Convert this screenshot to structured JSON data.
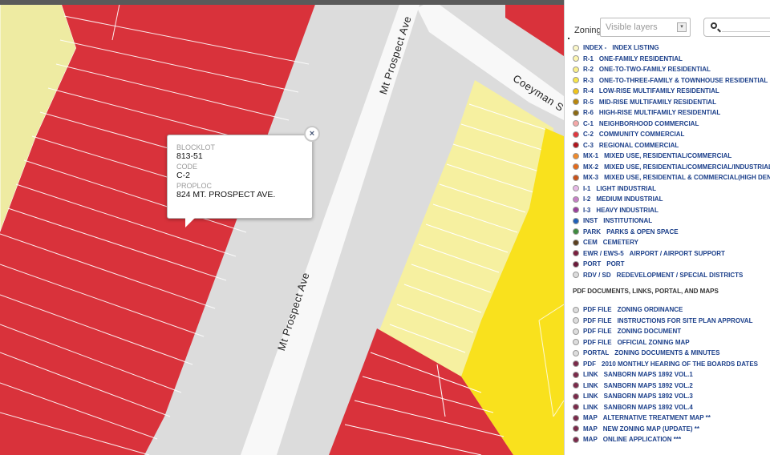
{
  "colors": {
    "commercial": "#d9323b",
    "light_residential": "#f6f0a0",
    "multi_residential": "#f9e11d",
    "pale_residential": "#eeeba2",
    "street": "#f8f8f8",
    "sidewalk": "#dcdcdc",
    "parcel_line": "#ffffff",
    "link_text": "#1b3f8a"
  },
  "map": {
    "streets": [
      {
        "name": "Mt Prospect Ave",
        "label": "Mt Prospect Ave"
      },
      {
        "name": "Mt Prospect Ave",
        "label": "Mt Prospect Ave"
      },
      {
        "name": "Coeyman St",
        "label": "Coeyman S"
      }
    ]
  },
  "popup": {
    "fields": [
      {
        "label": "BLOCKLOT",
        "value": "813-51"
      },
      {
        "label": "CODE",
        "value": "C-2"
      },
      {
        "label": "PROPLOC",
        "value": "824 MT. PROSPECT AVE."
      }
    ],
    "close_glyph": "×",
    "close_icon": "close-icon"
  },
  "panel": {
    "title": "Zoning",
    "layers_placeholder": "Visible layers",
    "search_icon": "search-icon",
    "legend": [
      {
        "code": "INDEX -",
        "desc": "INDEX LISTING",
        "color": "#fbf7c8"
      },
      {
        "code": "R-1",
        "desc": "ONE-FAMILY RESIDENTIAL",
        "color": "#fdf6b0"
      },
      {
        "code": "R-2",
        "desc": "ONE-TO-TWO-FAMILY RESIDENTIAL",
        "color": "#faef8a"
      },
      {
        "code": "R-3",
        "desc": "ONE-TO-THREE-FAMILY & TOWNHOUSE RESIDENTIAL",
        "color": "#f7e64a"
      },
      {
        "code": "R-4",
        "desc": "LOW-RISE MULTIFAMILY RESIDENTIAL",
        "color": "#f0c419"
      },
      {
        "code": "R-5",
        "desc": "MID-RISE MULTIFAMILY RESIDENTIAL",
        "color": "#b8860b"
      },
      {
        "code": "R-6",
        "desc": "HIGH-RISE MULTIFAMILY RESIDENTIAL",
        "color": "#8b6a14"
      },
      {
        "code": "C-1",
        "desc": "NEIGHBORHOOD COMMERCIAL",
        "color": "#f5a8a8"
      },
      {
        "code": "C-2",
        "desc": "COMMUNITY COMMERCIAL",
        "color": "#e0383f"
      },
      {
        "code": "C-3",
        "desc": "REGIONAL COMMERCIAL",
        "color": "#b0141c"
      },
      {
        "code": "MX-1",
        "desc": "MIXED USE, RESIDENTIAL/COMMERCIAL",
        "color": "#f08a2a"
      },
      {
        "code": "MX-2",
        "desc": "MIXED USE, RESIDENTIAL/COMMERCIAL/INDUSTRIAL",
        "color": "#e46a1a"
      },
      {
        "code": "MX-3",
        "desc": "MIXED USE, RESIDENTIAL & COMMERCIAL(HIGH DENS",
        "color": "#c8521a"
      },
      {
        "code": "I-1",
        "desc": "LIGHT INDUSTRIAL",
        "color": "#e6b8e6"
      },
      {
        "code": "I-2",
        "desc": "MEDIUM INDUSTRIAL",
        "color": "#c77fc7"
      },
      {
        "code": "I-3",
        "desc": "HEAVY INDUSTRIAL",
        "color": "#9a3f9a"
      },
      {
        "code": "INST",
        "desc": "INSTITUTIONAL",
        "color": "#1f5fb8"
      },
      {
        "code": "PARK",
        "desc": "PARKS & OPEN SPACE",
        "color": "#3f8a3f"
      },
      {
        "code": "CEM",
        "desc": "CEMETERY",
        "color": "#5a3f1f"
      },
      {
        "code": "EWR / EWS-5",
        "desc": "AIRPORT / AIRPORT SUPPORT",
        "color": "#7a1f3f"
      },
      {
        "code": "PORT",
        "desc": "PORT",
        "color": "#6a1a3a"
      },
      {
        "code": "RDV / SD",
        "desc": "REDEVELOPMENT / SPECIAL DISTRICTS",
        "color": "#dcdcdc"
      }
    ],
    "documents_heading": "PDF DOCUMENTS, LINKS, PORTAL, AND MAPS",
    "documents": [
      {
        "code": "PDF FILE",
        "desc": "ZONING ORDINANCE",
        "color": "#dddddd"
      },
      {
        "code": "PDF FILE",
        "desc": "INSTRUCTIONS FOR SITE PLAN APPROVAL",
        "color": "#dddddd"
      },
      {
        "code": "PDF FILE",
        "desc": "ZONING DOCUMENT",
        "color": "#dddddd"
      },
      {
        "code": "PDF FILE",
        "desc": "OFFICIAL ZONING MAP",
        "color": "#dddddd"
      },
      {
        "code": "PORTAL",
        "desc": "ZONING DOCUMENTS & MINUTES",
        "color": "#dddddd"
      },
      {
        "code": "PDF",
        "desc": "2010 MONTHLY HEARING OF THE BOARDS DATES",
        "color": "#7a2a4a"
      },
      {
        "code": "LINK",
        "desc": "SANBORN MAPS 1892 VOL.1",
        "color": "#7a2a4a"
      },
      {
        "code": "LINK",
        "desc": "SANBORN MAPS 1892 VOL.2",
        "color": "#7a2a4a"
      },
      {
        "code": "LINK",
        "desc": "SANBORN MAPS 1892 VOL.3",
        "color": "#7a2a4a"
      },
      {
        "code": "LINK",
        "desc": "SANBORN MAPS 1892 VOL.4",
        "color": "#7a2a4a"
      },
      {
        "code": "MAP",
        "desc": "ALTERNATIVE TREATMENT MAP **",
        "color": "#7a2a4a"
      },
      {
        "code": "MAP",
        "desc": "NEW ZONING MAP (UPDATE) **",
        "color": "#7a2a4a"
      },
      {
        "code": "MAP",
        "desc": "ONLINE APPLICATION ***",
        "color": "#7a2a4a"
      }
    ]
  }
}
